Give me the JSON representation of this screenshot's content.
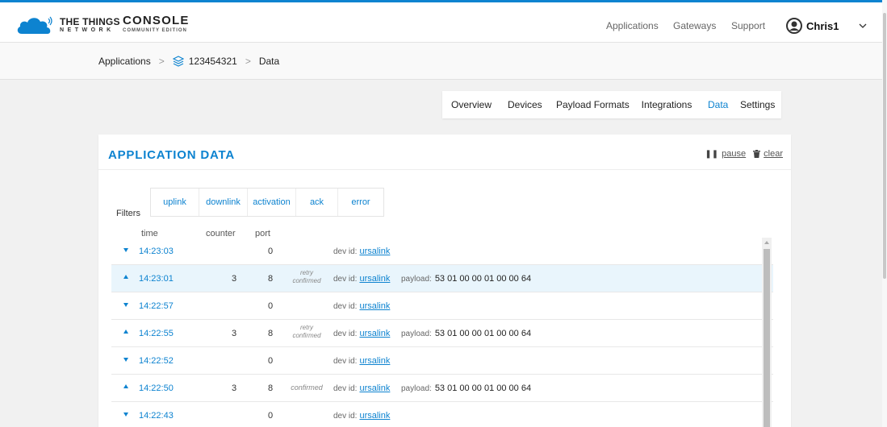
{
  "brand": {
    "name": "THE THINGS",
    "network": "NETWORK",
    "console": "CONSOLE",
    "edition": "COMMUNITY EDITION"
  },
  "topnav": {
    "applications": "Applications",
    "gateways": "Gateways",
    "support": "Support",
    "user": "Chris1"
  },
  "breadcrumb": {
    "applications": "Applications",
    "app_id": "123454321",
    "data": "Data"
  },
  "tabs": [
    "Overview",
    "Devices",
    "Payload Formats",
    "Integrations",
    "Data",
    "Settings"
  ],
  "active_tab": "Data",
  "card": {
    "title": "APPLICATION DATA",
    "pause": "pause",
    "clear": "clear"
  },
  "filters": {
    "label": "Filters",
    "items": [
      "uplink",
      "downlink",
      "activation",
      "ack",
      "error"
    ]
  },
  "columns": {
    "time": "time",
    "counter": "counter",
    "port": "port"
  },
  "rows": [
    {
      "dir": "down",
      "time": "14:23:03",
      "counter": "",
      "port": "0",
      "tag1": "",
      "tag2": "",
      "dev_label": "dev id:",
      "dev_id": "ursalink",
      "payload_label": "",
      "payload": ""
    },
    {
      "dir": "up",
      "time": "14:23:01",
      "counter": "3",
      "port": "8",
      "tag1": "retry",
      "tag2": "confirmed",
      "dev_label": "dev id:",
      "dev_id": "ursalink",
      "payload_label": "payload:",
      "payload": "53 01 00 00 01 00 00 64"
    },
    {
      "dir": "down",
      "time": "14:22:57",
      "counter": "",
      "port": "0",
      "tag1": "",
      "tag2": "",
      "dev_label": "dev id:",
      "dev_id": "ursalink",
      "payload_label": "",
      "payload": ""
    },
    {
      "dir": "up",
      "time": "14:22:55",
      "counter": "3",
      "port": "8",
      "tag1": "retry",
      "tag2": "confirmed",
      "dev_label": "dev id:",
      "dev_id": "ursalink",
      "payload_label": "payload:",
      "payload": "53 01 00 00 01 00 00 64"
    },
    {
      "dir": "down",
      "time": "14:22:52",
      "counter": "",
      "port": "0",
      "tag1": "",
      "tag2": "",
      "dev_label": "dev id:",
      "dev_id": "ursalink",
      "payload_label": "",
      "payload": ""
    },
    {
      "dir": "up",
      "time": "14:22:50",
      "counter": "3",
      "port": "8",
      "tag1": "confirmed",
      "tag2": "",
      "dev_label": "dev id:",
      "dev_id": "ursalink",
      "payload_label": "payload:",
      "payload": "53 01 00 00 01 00 00 64"
    },
    {
      "dir": "down",
      "time": "14:22:43",
      "counter": "",
      "port": "0",
      "tag1": "",
      "tag2": "",
      "dev_label": "dev id:",
      "dev_id": "ursalink",
      "payload_label": "",
      "payload": ""
    }
  ],
  "colors": {
    "accent": "#0d83d0",
    "highlight_row": "#e9f5fc"
  }
}
